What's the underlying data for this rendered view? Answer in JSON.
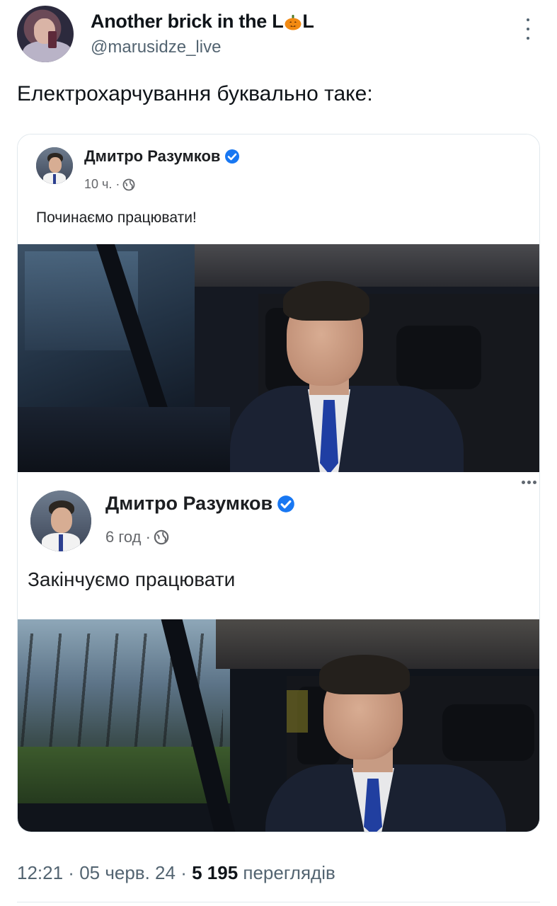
{
  "tweet": {
    "display_name_prefix": "Another brick in the L",
    "display_name_suffix": "L",
    "display_name_emoji": "pumpkin-icon",
    "handle": "@marusidze_live",
    "text": "Електрохарчування буквально таке:",
    "more_icon": "vertical-dots-icon"
  },
  "embedded_posts": [
    {
      "author": "Дмитро Разумков",
      "verified": true,
      "time": "10 ч. · ",
      "privacy_icon": "globe-icon",
      "text": "Починаємо працювати!"
    },
    {
      "author": "Дмитро Разумков",
      "verified": true,
      "time": "6 год · ",
      "privacy_icon": "globe-icon",
      "text": "Закінчуємо працювати"
    }
  ],
  "footer": {
    "time": "12:21",
    "separator": " · ",
    "date": "05 черв. 24",
    "views_count": "5 195",
    "views_label": " переглядів"
  },
  "colors": {
    "verified_blue": "#1877f2",
    "secondary_text": "#536471"
  }
}
